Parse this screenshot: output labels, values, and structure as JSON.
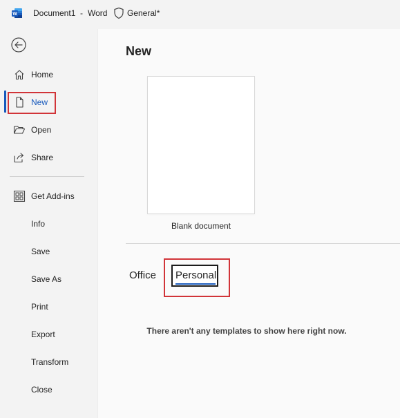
{
  "titlebar": {
    "document_name": "Document1",
    "separator": "-",
    "app_name": "Word",
    "sensitivity_label": "General*"
  },
  "sidebar": {
    "back_icon": "back-arrow-icon",
    "items": [
      {
        "label": "Home",
        "icon": "home-icon"
      },
      {
        "label": "New",
        "icon": "new-document-icon",
        "active": true
      },
      {
        "label": "Open",
        "icon": "folder-open-icon"
      },
      {
        "label": "Share",
        "icon": "share-icon"
      },
      {
        "label": "Get Add-ins",
        "icon": "add-ins-grid-icon"
      },
      {
        "label": "Info"
      },
      {
        "label": "Save"
      },
      {
        "label": "Save As"
      },
      {
        "label": "Print"
      },
      {
        "label": "Export"
      },
      {
        "label": "Transform"
      },
      {
        "label": "Close"
      }
    ]
  },
  "main": {
    "title": "New",
    "blank_template_label": "Blank document",
    "tabs": [
      {
        "label": "Office"
      },
      {
        "label": "Personal",
        "selected": true
      }
    ],
    "empty_message": "There aren't any templates to show here right now."
  },
  "colors": {
    "accent": "#185abd",
    "highlight_box": "#d13438",
    "sidebar_bg": "#f3f3f3",
    "main_bg": "#fafafa"
  }
}
